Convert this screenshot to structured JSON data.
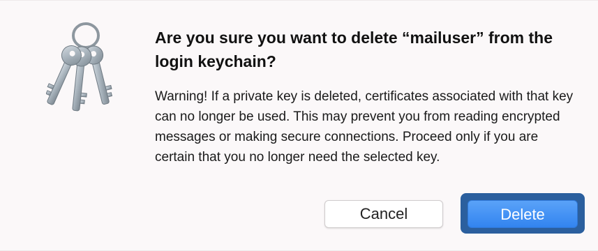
{
  "dialog": {
    "icon": "keychain-keys-icon",
    "title": "Are you sure you want to delete “mailuser” from the login keychain?",
    "message": "Warning! If a private key is deleted, certificates associated with that key can no longer be used. This may prevent you from reading encrypted messages or making secure connections. Proceed only if you are certain that you no longer need the selected key.",
    "buttons": {
      "cancel_label": "Cancel",
      "delete_label": "Delete"
    },
    "default_button": "Delete",
    "accent_color": "#3284f0"
  }
}
